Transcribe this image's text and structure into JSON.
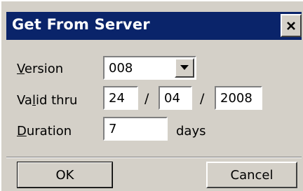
{
  "window": {
    "title": "Get From Server",
    "close_glyph": "×"
  },
  "form": {
    "version": {
      "label_mnemonic": "V",
      "label_rest": "ersion",
      "value": "008"
    },
    "valid_thru": {
      "label_pre": "Va",
      "label_mnemonic": "l",
      "label_post": "id thru",
      "day": "24",
      "month": "04",
      "year": "2008",
      "separator": "/"
    },
    "duration": {
      "label_mnemonic": "D",
      "label_rest": "uration",
      "value": "7",
      "unit": "days"
    }
  },
  "buttons": {
    "ok_label": "OK",
    "cancel_label": "Cancel"
  },
  "colors": {
    "titlebar": "#0a246a",
    "dialog_face": "#d4d0c8"
  }
}
